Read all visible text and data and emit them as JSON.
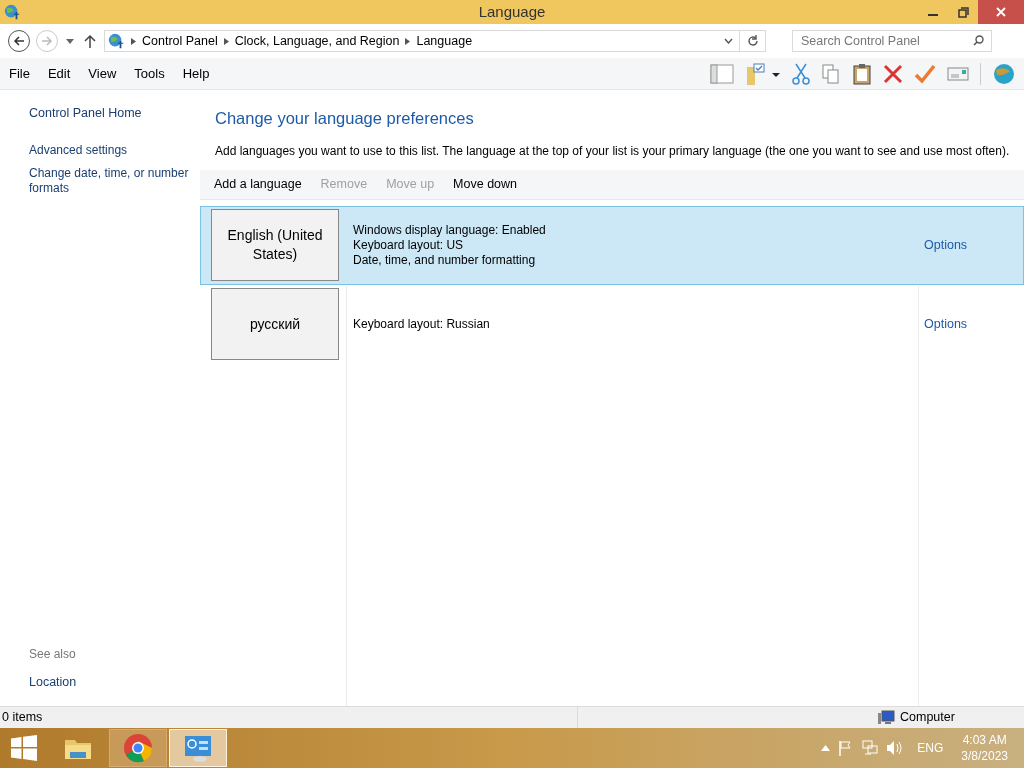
{
  "window": {
    "title": "Language"
  },
  "breadcrumb": [
    "Control Panel",
    "Clock, Language, and Region",
    "Language"
  ],
  "search": {
    "placeholder": "Search Control Panel"
  },
  "menu": [
    "File",
    "Edit",
    "View",
    "Tools",
    "Help"
  ],
  "sidebar": {
    "links": [
      "Control Panel Home",
      "Advanced settings",
      "Change date, time, or number formats"
    ],
    "see_also_title": "See also",
    "see_also": [
      "Location"
    ]
  },
  "heading": "Change your language preferences",
  "description": "Add languages you want to use to this list. The language at the top of your list is your primary language (the one you want to see and use most often).",
  "actions": [
    {
      "label": "Add a language",
      "disabled": false
    },
    {
      "label": "Remove",
      "disabled": true
    },
    {
      "label": "Move up",
      "disabled": true
    },
    {
      "label": "Move down",
      "disabled": false
    }
  ],
  "languages": [
    {
      "name": "English (United States)",
      "selected": true,
      "details": [
        "Windows display language: Enabled",
        "Keyboard layout: US",
        "Date, time, and number formatting"
      ],
      "options": "Options"
    },
    {
      "name": "русский",
      "selected": false,
      "details": [
        "Keyboard layout: Russian"
      ],
      "options": "Options"
    }
  ],
  "status_bar": {
    "items": "0 items",
    "zone": "Computer"
  },
  "taskbar": {
    "apps": [
      {
        "kind": "explorer",
        "selected": false
      },
      {
        "kind": "chrome",
        "selected": false
      },
      {
        "kind": "control-panel",
        "selected": true
      }
    ],
    "input_language": "ENG",
    "time": "4:03 AM",
    "date": "3/8/2023"
  }
}
